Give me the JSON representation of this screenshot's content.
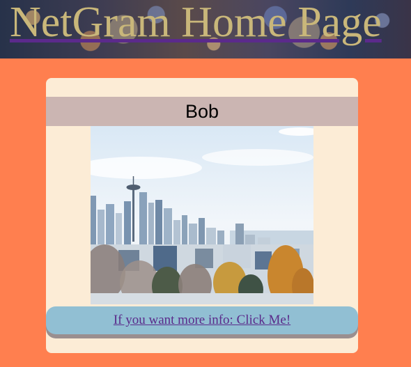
{
  "header": {
    "title": "NetGram Home Page",
    "title_color": "#c9b77a",
    "underline_color": "#5b2a8c"
  },
  "page": {
    "background_color": "#ff7f4f"
  },
  "profile": {
    "name": "Bob",
    "photo": "city-skyline-photo",
    "more_info_link": "If you want more info: Click Me!",
    "card_color": "#fcecd6",
    "name_bar_color": "#cbb5b2",
    "link_bar_color": "#91bfd3",
    "link_color": "#5a2a8a"
  }
}
